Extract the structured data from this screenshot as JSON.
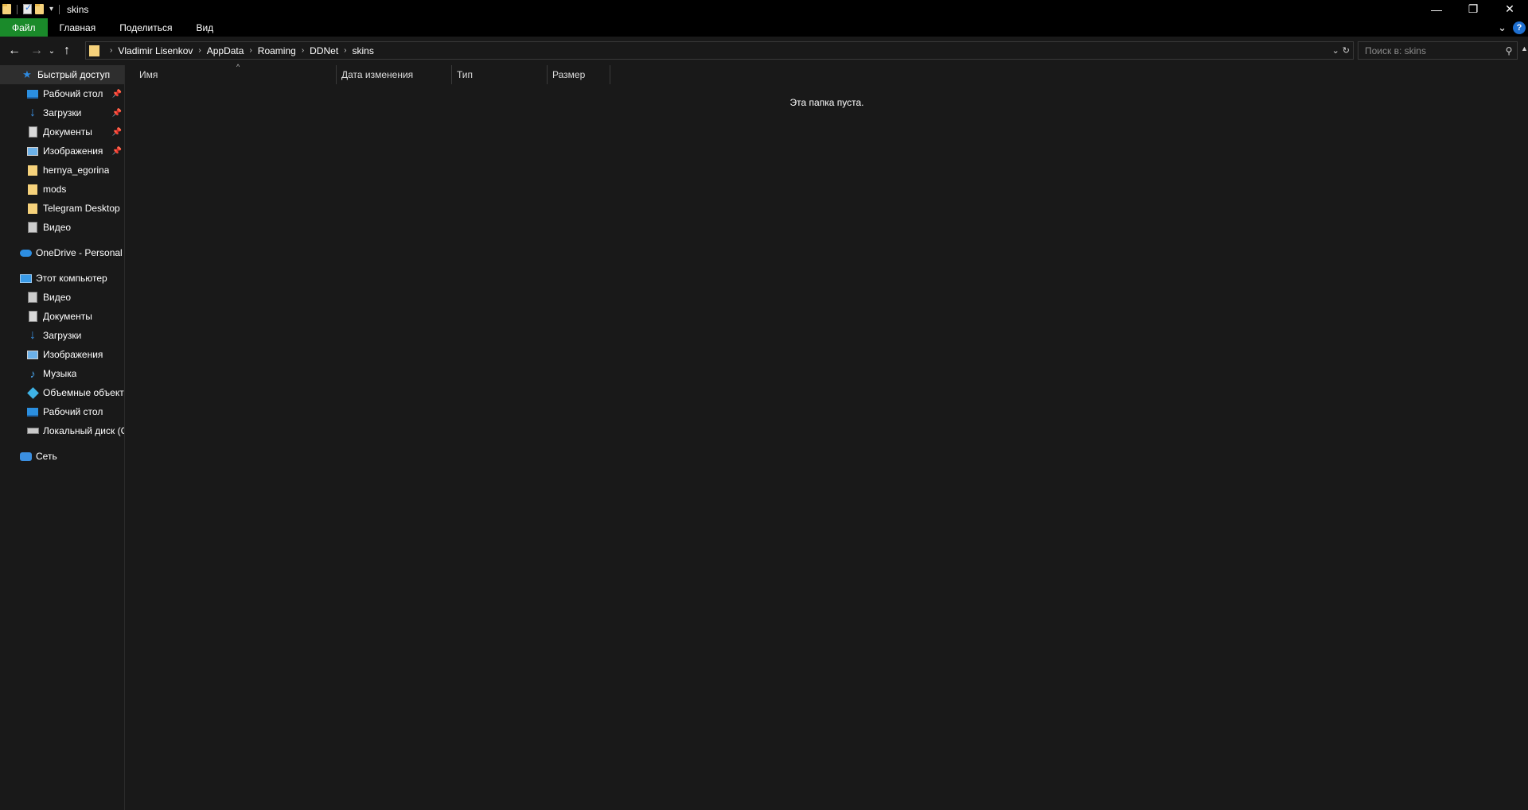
{
  "titlebar": {
    "title": "skins",
    "icons": [
      "folder-icon",
      "properties-icon",
      "new-folder-icon",
      "customize-arrow-icon"
    ],
    "controls": {
      "minimize": "—",
      "maximize": "❐",
      "close": "✕"
    }
  },
  "ribbon": {
    "tabs": [
      {
        "label": "Файл"
      },
      {
        "label": "Главная"
      },
      {
        "label": "Поделиться"
      },
      {
        "label": "Вид"
      }
    ],
    "file_tab_color": "#1a8a2a"
  },
  "address": {
    "crumbs": [
      "Vladimir Lisenkov",
      "AppData",
      "Roaming",
      "DDNet",
      "skins"
    ]
  },
  "search": {
    "placeholder": "Поиск в: skins"
  },
  "sidebar": {
    "quick_access": {
      "label": "Быстрый доступ",
      "items": [
        {
          "label": "Рабочий стол",
          "icon": "desktop-icon",
          "pinned": true
        },
        {
          "label": "Загрузки",
          "icon": "downloads-icon",
          "pinned": true
        },
        {
          "label": "Документы",
          "icon": "documents-icon",
          "pinned": true
        },
        {
          "label": "Изображения",
          "icon": "pictures-icon",
          "pinned": true
        },
        {
          "label": "hernya_egorina",
          "icon": "folder-icon",
          "pinned": false
        },
        {
          "label": "mods",
          "icon": "folder-icon",
          "pinned": false
        },
        {
          "label": "Telegram Desktop",
          "icon": "folder-icon",
          "pinned": false
        },
        {
          "label": "Видео",
          "icon": "videos-icon",
          "pinned": false
        }
      ]
    },
    "onedrive": {
      "label": "OneDrive - Personal"
    },
    "this_pc": {
      "label": "Этот компьютер",
      "items": [
        {
          "label": "Видео",
          "icon": "videos-icon"
        },
        {
          "label": "Документы",
          "icon": "documents-icon"
        },
        {
          "label": "Загрузки",
          "icon": "downloads-icon"
        },
        {
          "label": "Изображения",
          "icon": "pictures-icon"
        },
        {
          "label": "Музыка",
          "icon": "music-icon"
        },
        {
          "label": "Объемные объекты",
          "icon": "3d-objects-icon"
        },
        {
          "label": "Рабочий стол",
          "icon": "desktop-icon"
        },
        {
          "label": "Локальный диск (C",
          "icon": "local-disk-icon"
        }
      ]
    },
    "network": {
      "label": "Сеть"
    }
  },
  "content": {
    "columns": [
      "Имя",
      "Дата изменения",
      "Тип",
      "Размер"
    ],
    "empty_message": "Эта папка пуста."
  }
}
